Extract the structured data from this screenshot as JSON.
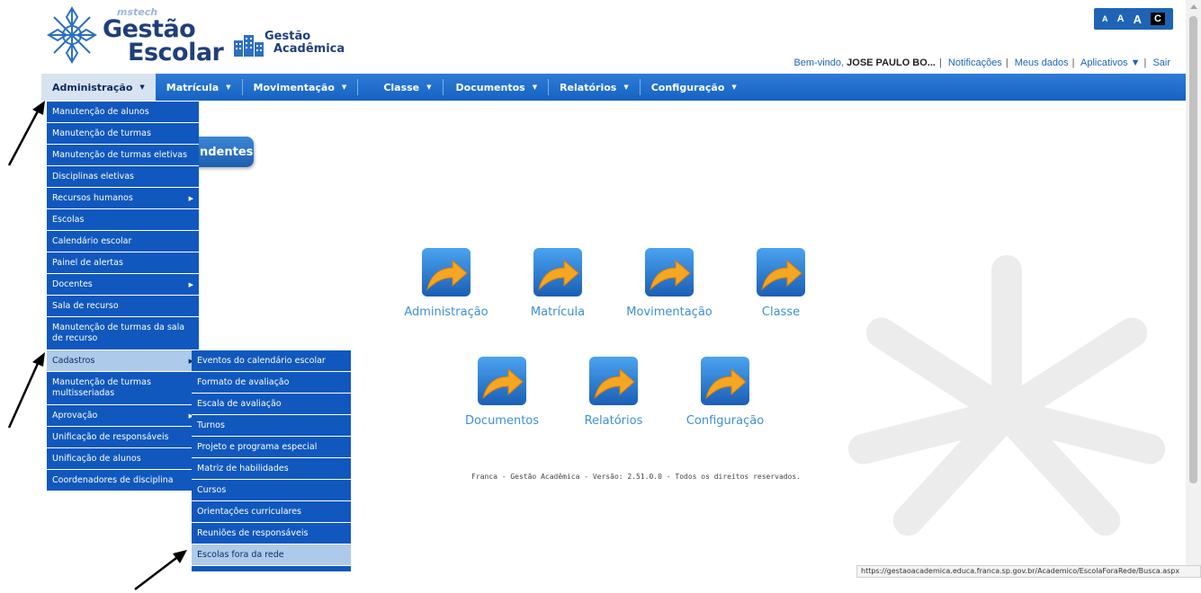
{
  "header": {
    "brand": "mstech",
    "logo_line1": "Gestão",
    "logo_line2": "Escolar",
    "app_line1": "Gestão",
    "app_line2": "Acadêmica",
    "font_buttons": [
      "A",
      "A",
      "A",
      "C"
    ]
  },
  "user_bar": {
    "welcome": "Bem-vindo,",
    "user_name": "JOSE PAULO BO...",
    "links": [
      "Notificações",
      "Meus dados",
      "Aplicativos ▼",
      "Sair"
    ]
  },
  "menubar": {
    "items": [
      {
        "label": "Administração",
        "active": true
      },
      {
        "label": "Matrícula",
        "active": false
      },
      {
        "label": "Movimentação",
        "active": false
      },
      {
        "label": "Classe",
        "active": false
      },
      {
        "label": "Documentos",
        "active": false
      },
      {
        "label": "Relatórios",
        "active": false
      },
      {
        "label": "Configuração",
        "active": false
      }
    ]
  },
  "admin_menu": [
    {
      "label": "Manutenção de alunos",
      "submenu": false
    },
    {
      "label": "Manutenção de turmas",
      "submenu": false
    },
    {
      "label": "Manutenção de turmas eletivas",
      "submenu": false
    },
    {
      "label": "Disciplinas eletivas",
      "submenu": false
    },
    {
      "label": "Recursos humanos",
      "submenu": true
    },
    {
      "label": "Escolas",
      "submenu": false
    },
    {
      "label": "Calendário escolar",
      "submenu": false
    },
    {
      "label": "Painel de alertas",
      "submenu": false
    },
    {
      "label": "Docentes",
      "submenu": true
    },
    {
      "label": "Sala de recurso",
      "submenu": false
    },
    {
      "label": "Manutenção de turmas da sala de recurso",
      "submenu": false
    },
    {
      "label": "Cadastros",
      "submenu": true,
      "highlighted": true
    },
    {
      "label": "Manutenção de turmas multisseriadas",
      "submenu": false
    },
    {
      "label": "Aprovação",
      "submenu": true
    },
    {
      "label": "Unificação de responsáveis",
      "submenu": false
    },
    {
      "label": "Unificação de alunos",
      "submenu": false
    },
    {
      "label": "Coordenadores de disciplina",
      "submenu": false
    }
  ],
  "cadastros_menu": [
    {
      "label": "Eventos do calendário escolar"
    },
    {
      "label": "Formato de avaliação"
    },
    {
      "label": "Escala de avaliação"
    },
    {
      "label": "Turnos"
    },
    {
      "label": "Projeto e programa especial"
    },
    {
      "label": "Matriz de habilidades"
    },
    {
      "label": "Cursos"
    },
    {
      "label": "Orientações curriculares"
    },
    {
      "label": "Reuniões de responsáveis"
    },
    {
      "label": "Escolas fora da rede",
      "highlighted": true
    }
  ],
  "heading_pill": "ndentes",
  "shortcuts": [
    {
      "label": "Administração"
    },
    {
      "label": "Matrícula"
    },
    {
      "label": "Movimentação"
    },
    {
      "label": "Classe"
    },
    {
      "label": "Documentos"
    },
    {
      "label": "Relatórios"
    },
    {
      "label": "Configuração"
    }
  ],
  "footer": "Franca - Gestão Acadêmica - Versão: 2.51.0.0 - Todos os direitos reservados.",
  "status_url": "https://gestaoacademica.educa.franca.sp.gov.br/Academico/EscolaForaRede/Busca.aspx",
  "colors": {
    "menubar": "#1563c2",
    "dropdown": "#1058bd",
    "dropdown_highlight": "#aecaeb",
    "shortcut_label": "#3e8fd4",
    "logo_text": "#1f3f7a"
  }
}
